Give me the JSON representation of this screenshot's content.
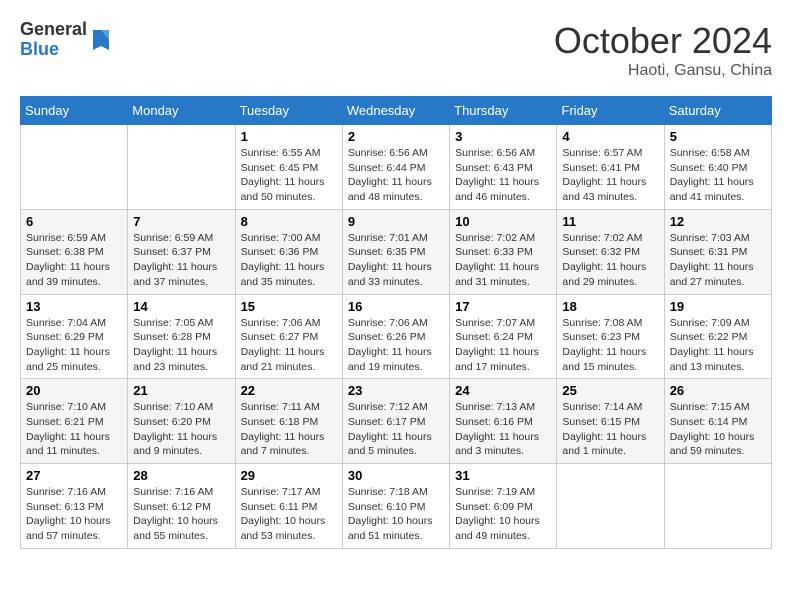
{
  "header": {
    "logo_general": "General",
    "logo_blue": "Blue",
    "month_title": "October 2024",
    "location": "Haoti, Gansu, China"
  },
  "weekdays": [
    "Sunday",
    "Monday",
    "Tuesday",
    "Wednesday",
    "Thursday",
    "Friday",
    "Saturday"
  ],
  "weeks": [
    [
      {
        "day": "",
        "sunrise": "",
        "sunset": "",
        "daylight": ""
      },
      {
        "day": "",
        "sunrise": "",
        "sunset": "",
        "daylight": ""
      },
      {
        "day": "1",
        "sunrise": "Sunrise: 6:55 AM",
        "sunset": "Sunset: 6:45 PM",
        "daylight": "Daylight: 11 hours and 50 minutes."
      },
      {
        "day": "2",
        "sunrise": "Sunrise: 6:56 AM",
        "sunset": "Sunset: 6:44 PM",
        "daylight": "Daylight: 11 hours and 48 minutes."
      },
      {
        "day": "3",
        "sunrise": "Sunrise: 6:56 AM",
        "sunset": "Sunset: 6:43 PM",
        "daylight": "Daylight: 11 hours and 46 minutes."
      },
      {
        "day": "4",
        "sunrise": "Sunrise: 6:57 AM",
        "sunset": "Sunset: 6:41 PM",
        "daylight": "Daylight: 11 hours and 43 minutes."
      },
      {
        "day": "5",
        "sunrise": "Sunrise: 6:58 AM",
        "sunset": "Sunset: 6:40 PM",
        "daylight": "Daylight: 11 hours and 41 minutes."
      }
    ],
    [
      {
        "day": "6",
        "sunrise": "Sunrise: 6:59 AM",
        "sunset": "Sunset: 6:38 PM",
        "daylight": "Daylight: 11 hours and 39 minutes."
      },
      {
        "day": "7",
        "sunrise": "Sunrise: 6:59 AM",
        "sunset": "Sunset: 6:37 PM",
        "daylight": "Daylight: 11 hours and 37 minutes."
      },
      {
        "day": "8",
        "sunrise": "Sunrise: 7:00 AM",
        "sunset": "Sunset: 6:36 PM",
        "daylight": "Daylight: 11 hours and 35 minutes."
      },
      {
        "day": "9",
        "sunrise": "Sunrise: 7:01 AM",
        "sunset": "Sunset: 6:35 PM",
        "daylight": "Daylight: 11 hours and 33 minutes."
      },
      {
        "day": "10",
        "sunrise": "Sunrise: 7:02 AM",
        "sunset": "Sunset: 6:33 PM",
        "daylight": "Daylight: 11 hours and 31 minutes."
      },
      {
        "day": "11",
        "sunrise": "Sunrise: 7:02 AM",
        "sunset": "Sunset: 6:32 PM",
        "daylight": "Daylight: 11 hours and 29 minutes."
      },
      {
        "day": "12",
        "sunrise": "Sunrise: 7:03 AM",
        "sunset": "Sunset: 6:31 PM",
        "daylight": "Daylight: 11 hours and 27 minutes."
      }
    ],
    [
      {
        "day": "13",
        "sunrise": "Sunrise: 7:04 AM",
        "sunset": "Sunset: 6:29 PM",
        "daylight": "Daylight: 11 hours and 25 minutes."
      },
      {
        "day": "14",
        "sunrise": "Sunrise: 7:05 AM",
        "sunset": "Sunset: 6:28 PM",
        "daylight": "Daylight: 11 hours and 23 minutes."
      },
      {
        "day": "15",
        "sunrise": "Sunrise: 7:06 AM",
        "sunset": "Sunset: 6:27 PM",
        "daylight": "Daylight: 11 hours and 21 minutes."
      },
      {
        "day": "16",
        "sunrise": "Sunrise: 7:06 AM",
        "sunset": "Sunset: 6:26 PM",
        "daylight": "Daylight: 11 hours and 19 minutes."
      },
      {
        "day": "17",
        "sunrise": "Sunrise: 7:07 AM",
        "sunset": "Sunset: 6:24 PM",
        "daylight": "Daylight: 11 hours and 17 minutes."
      },
      {
        "day": "18",
        "sunrise": "Sunrise: 7:08 AM",
        "sunset": "Sunset: 6:23 PM",
        "daylight": "Daylight: 11 hours and 15 minutes."
      },
      {
        "day": "19",
        "sunrise": "Sunrise: 7:09 AM",
        "sunset": "Sunset: 6:22 PM",
        "daylight": "Daylight: 11 hours and 13 minutes."
      }
    ],
    [
      {
        "day": "20",
        "sunrise": "Sunrise: 7:10 AM",
        "sunset": "Sunset: 6:21 PM",
        "daylight": "Daylight: 11 hours and 11 minutes."
      },
      {
        "day": "21",
        "sunrise": "Sunrise: 7:10 AM",
        "sunset": "Sunset: 6:20 PM",
        "daylight": "Daylight: 11 hours and 9 minutes."
      },
      {
        "day": "22",
        "sunrise": "Sunrise: 7:11 AM",
        "sunset": "Sunset: 6:18 PM",
        "daylight": "Daylight: 11 hours and 7 minutes."
      },
      {
        "day": "23",
        "sunrise": "Sunrise: 7:12 AM",
        "sunset": "Sunset: 6:17 PM",
        "daylight": "Daylight: 11 hours and 5 minutes."
      },
      {
        "day": "24",
        "sunrise": "Sunrise: 7:13 AM",
        "sunset": "Sunset: 6:16 PM",
        "daylight": "Daylight: 11 hours and 3 minutes."
      },
      {
        "day": "25",
        "sunrise": "Sunrise: 7:14 AM",
        "sunset": "Sunset: 6:15 PM",
        "daylight": "Daylight: 11 hours and 1 minute."
      },
      {
        "day": "26",
        "sunrise": "Sunrise: 7:15 AM",
        "sunset": "Sunset: 6:14 PM",
        "daylight": "Daylight: 10 hours and 59 minutes."
      }
    ],
    [
      {
        "day": "27",
        "sunrise": "Sunrise: 7:16 AM",
        "sunset": "Sunset: 6:13 PM",
        "daylight": "Daylight: 10 hours and 57 minutes."
      },
      {
        "day": "28",
        "sunrise": "Sunrise: 7:16 AM",
        "sunset": "Sunset: 6:12 PM",
        "daylight": "Daylight: 10 hours and 55 minutes."
      },
      {
        "day": "29",
        "sunrise": "Sunrise: 7:17 AM",
        "sunset": "Sunset: 6:11 PM",
        "daylight": "Daylight: 10 hours and 53 minutes."
      },
      {
        "day": "30",
        "sunrise": "Sunrise: 7:18 AM",
        "sunset": "Sunset: 6:10 PM",
        "daylight": "Daylight: 10 hours and 51 minutes."
      },
      {
        "day": "31",
        "sunrise": "Sunrise: 7:19 AM",
        "sunset": "Sunset: 6:09 PM",
        "daylight": "Daylight: 10 hours and 49 minutes."
      },
      {
        "day": "",
        "sunrise": "",
        "sunset": "",
        "daylight": ""
      },
      {
        "day": "",
        "sunrise": "",
        "sunset": "",
        "daylight": ""
      }
    ]
  ]
}
